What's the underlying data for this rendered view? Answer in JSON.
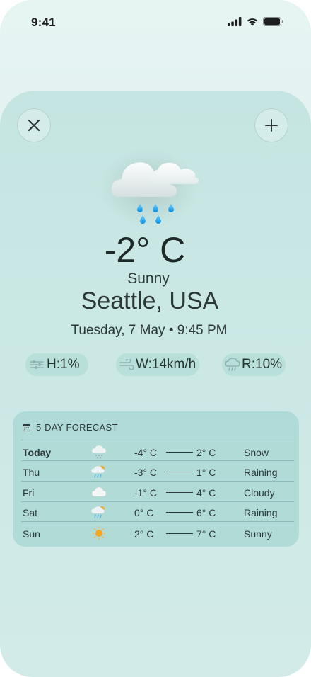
{
  "status_bar": {
    "time": "9:41"
  },
  "weather": {
    "temperature": "-2° C",
    "condition": "Sunny",
    "city": "Seattle, USA",
    "datetime": "Tuesday, 7 May • 9:45 PM"
  },
  "stats": {
    "humidity": "H:1%",
    "wind": "W:14km/h",
    "rain": "R:10%"
  },
  "forecast": {
    "title": "5-DAY FORECAST",
    "rows": [
      {
        "day": "Today",
        "icon": "snow-cloud-icon",
        "low": "-4° C",
        "high": "2° C",
        "condition": "Snow"
      },
      {
        "day": "Thu",
        "icon": "rain-sun-cloud-icon",
        "low": "-3° C",
        "high": "1° C",
        "condition": "Raining"
      },
      {
        "day": "Fri",
        "icon": "cloud-icon",
        "low": "-1° C",
        "high": "4° C",
        "condition": "Cloudy"
      },
      {
        "day": "Sat",
        "icon": "rain-sun-cloud-icon",
        "low": "0° C",
        "high": "6° C",
        "condition": "Raining"
      },
      {
        "day": "Sun",
        "icon": "sun-icon",
        "low": "2° C",
        "high": "7° C",
        "condition": "Sunny"
      }
    ]
  },
  "colors": {
    "background": "#e6f4f2",
    "sheet": "#c8e6e3",
    "card": "#a5d6d2",
    "raindrop": "#1ba0e6",
    "sun": "#f5a623"
  }
}
